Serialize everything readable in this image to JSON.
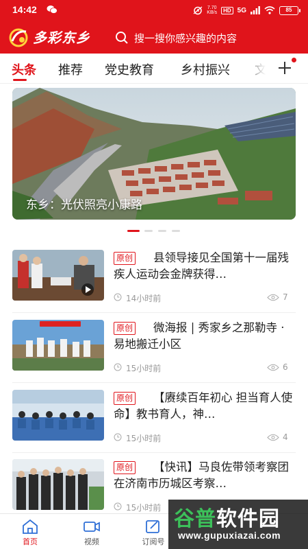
{
  "status_bar": {
    "time": "14:42",
    "speed_value": "7.70",
    "speed_unit": "KB/s",
    "hd_label": "HD",
    "network": "5G",
    "battery": "85"
  },
  "header": {
    "brand": "多彩东乡",
    "search_placeholder": "搜一搜你感兴趣的内容"
  },
  "tabs": [
    {
      "label": "头条",
      "active": true
    },
    {
      "label": "推荐"
    },
    {
      "label": "党史教育"
    },
    {
      "label": "乡村振兴"
    },
    {
      "label": "文"
    }
  ],
  "banner": {
    "caption": "东乡：光伏照亮小康路",
    "page_count": 4,
    "active_index": 0
  },
  "news": [
    {
      "badge": "原创",
      "title": "县领导接见全国第十一届残疾人运动会金牌获得…",
      "time": "14小时前",
      "views": "7",
      "has_video": true
    },
    {
      "badge": "原创",
      "title": "微海报 | 秀家乡之那勒寺 · 易地搬迁小区",
      "time": "15小时前",
      "views": "6"
    },
    {
      "badge": "原创",
      "title": "【赓续百年初心 担当育人使命】教书育人，神…",
      "time": "15小时前",
      "views": "4"
    },
    {
      "badge": "原创",
      "title": "【快讯】马良佐带领考察团在济南市历城区考察…",
      "time": "15小时前",
      "views": ""
    }
  ],
  "bottom_nav": [
    {
      "label": "首页",
      "icon": "home-icon",
      "active": true
    },
    {
      "label": "视频",
      "icon": "video-icon"
    },
    {
      "label": "订阅号",
      "icon": "subscribe-icon"
    }
  ],
  "watermark": {
    "text_a": "谷普",
    "text_b": "软件园",
    "url": "www.gupuxiazai.com"
  },
  "colors": {
    "brand_red": "#e0141b",
    "muted_text": "#999999"
  }
}
